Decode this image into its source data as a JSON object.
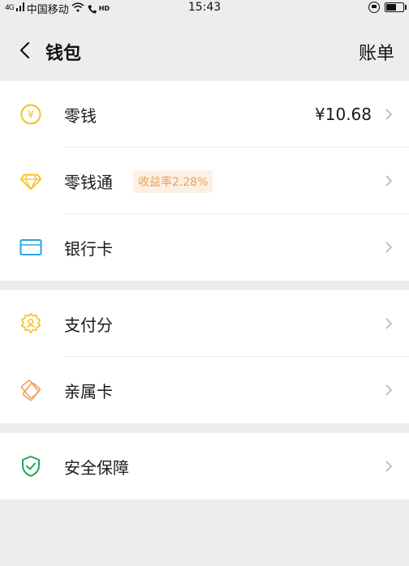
{
  "status_bar": {
    "network": "4G",
    "carrier": "中国移动",
    "hd": "HD",
    "time": "15:43"
  },
  "nav": {
    "title": "钱包",
    "right_label": "账单"
  },
  "groups": [
    {
      "items": [
        {
          "label": "零钱",
          "value": "¥10.68",
          "icon": "yuan-coin-icon"
        },
        {
          "label": "零钱通",
          "badge": "收益率2.28%",
          "icon": "diamond-icon"
        },
        {
          "label": "银行卡",
          "icon": "bank-card-icon"
        }
      ]
    },
    {
      "items": [
        {
          "label": "支付分",
          "icon": "pay-score-badge-icon"
        },
        {
          "label": "亲属卡",
          "icon": "family-card-icon"
        }
      ]
    },
    {
      "items": [
        {
          "label": "安全保障",
          "icon": "shield-check-icon"
        }
      ]
    }
  ],
  "colors": {
    "background": "#ededed",
    "card": "#ffffff",
    "yellow": "#f5c21b",
    "blue": "#2ba4e6",
    "orange": "#f0a35b",
    "green": "#1ea855",
    "badge_text": "#e9a15a",
    "badge_bg": "#fdf0e3"
  }
}
